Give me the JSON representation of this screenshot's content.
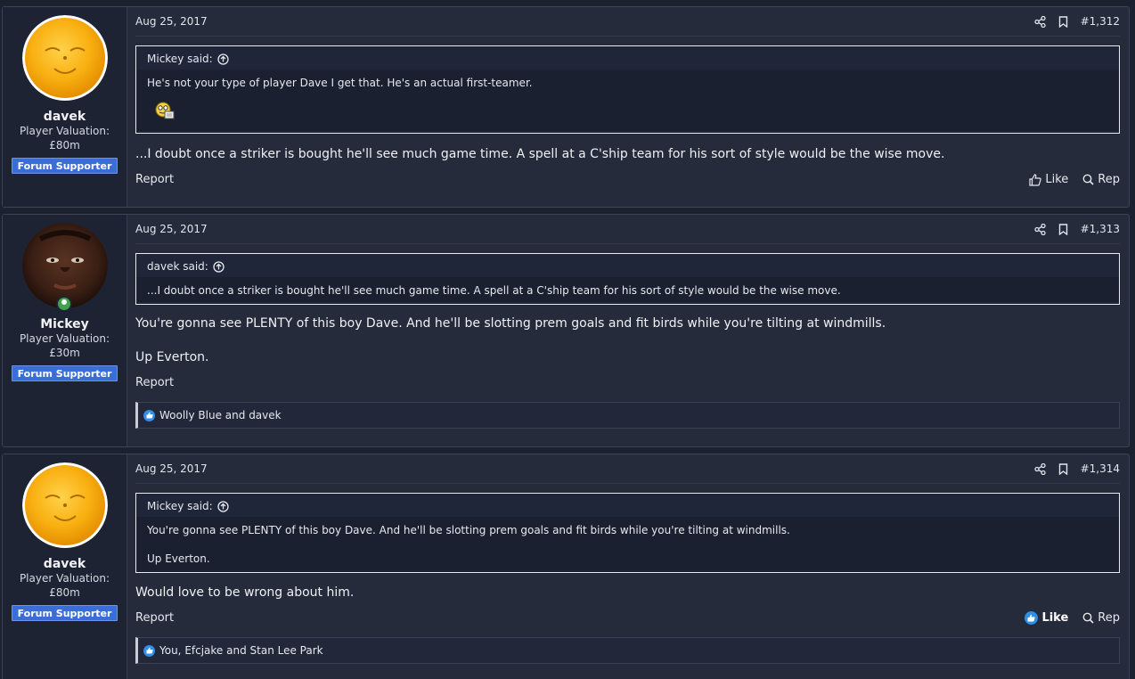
{
  "posts": [
    {
      "username": "davek",
      "valuation_label": "Player Valuation:",
      "valuation": "£80m",
      "badge": "Forum Supporter",
      "avatar": "orange-face",
      "date": "Aug 25, 2017",
      "post_number": "#1,312",
      "quote": {
        "author": "Mickey said:",
        "lines": [
          "He's not your type of player Dave I get that. He's an actual first-teamer."
        ]
      },
      "message": [
        "...I doubt once a striker is bought he'll see much game time. A spell at a C'ship team for his sort of style would be the wise move."
      ],
      "report": "Report",
      "like": "Like",
      "rep": "Rep",
      "reactions": ""
    },
    {
      "username": "Mickey",
      "valuation_label": "Player Valuation:",
      "valuation": "£30m",
      "badge": "Forum Supporter",
      "avatar": "man-photo",
      "date": "Aug 25, 2017",
      "post_number": "#1,313",
      "quote": {
        "author": "davek said:",
        "lines": [
          "...I doubt once a striker is bought he'll see much game time. A spell at a C'ship team for his sort of style would be the wise move."
        ]
      },
      "message": [
        "You're gonna see PLENTY of this boy Dave. And he'll be slotting prem goals and fit birds while you're tilting at windmills.",
        "Up Everton."
      ],
      "report": "Report",
      "reactions": "Woolly Blue and davek"
    },
    {
      "username": "davek",
      "valuation_label": "Player Valuation:",
      "valuation": "£80m",
      "badge": "Forum Supporter",
      "avatar": "orange-face",
      "date": "Aug 25, 2017",
      "post_number": "#1,314",
      "quote": {
        "author": "Mickey said:",
        "lines": [
          "You're gonna see PLENTY of this boy Dave. And he'll be slotting prem goals and fit birds while you're tilting at windmills.",
          "Up Everton."
        ]
      },
      "message": [
        "Would love to be wrong about him."
      ],
      "report": "Report",
      "like": "Like",
      "rep": "Rep",
      "reactions": "You, Efcjake and Stan Lee Park"
    }
  ],
  "colors": {
    "background": "#1c2130",
    "post_bg": "#252b3b",
    "badge": "#3a6dd6",
    "like_blue": "#2f8fe6"
  }
}
